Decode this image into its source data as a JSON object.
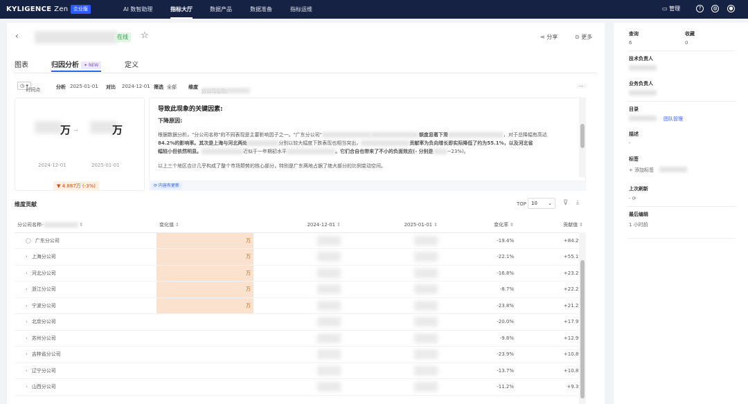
{
  "nav": {
    "brand": "KYLIGENCE",
    "brand_suffix": "Zen",
    "edition": "企业版",
    "items": [
      "AI 数智助理",
      "指标大厅",
      "数据产品",
      "数据准备",
      "指标运维"
    ],
    "active_index": 1,
    "manage": "管理"
  },
  "header": {
    "status": "在线",
    "share": "分享",
    "more": "更多"
  },
  "tabs": [
    {
      "label": "图表"
    },
    {
      "label": "归因分析",
      "badge": "NEW"
    },
    {
      "label": "定义"
    }
  ],
  "filter_bar": {
    "time": "时间点",
    "analyze_label": "分析",
    "analyze_value": "2025-01-01",
    "compare_label": "对比",
    "compare_value": "2024-12-01",
    "filter_label": "筛选",
    "filter_value": "全部",
    "dim_label": "维度",
    "dim_value": "分公司名称,",
    "more": "···"
  },
  "kpi": {
    "unit_a": "万",
    "unit_b": "万",
    "arrow": "→",
    "date_a": "2024-12-01",
    "date_b": "2025-01-01",
    "delta": "▼ 4.887万 (-3%)"
  },
  "analysis": {
    "heading": "导致此现象的关键因素:",
    "subheading": "下降原因:",
    "p1_a": "根据数据分析，\"分公司名称\"的不同表现是主要影响因子之一。\"广东分公司\"",
    "p1_b": "额度显著下滑",
    "p1_c": "，对于总降幅有高达",
    "p2_a": "84.2%的影响率。其次是上海与河北两处",
    "p2_b": "分别以较大幅度下跌表现也相当突出，",
    "p2_c": "贡献率为负向增长即实际降低了约为55.1%，以及河北省",
    "p3_a": "幅较小但依然明显。",
    "p3_b": "近似于一年期初水平",
    "p3_c": "。它们合自也带来了不小的负面效应(- 分别是",
    "p3_d": "~23%)。",
    "p4": "以上三个地区合计几乎构成了整个市场颓势的核心部分，特别是广东两地占据了绝大部分的比例变动空间。",
    "updated": "⟳ 内容有更新"
  },
  "dimension": {
    "title": "维度贡献",
    "top_label": "TOP",
    "top_value": "10",
    "columns": [
      "分公司名称-",
      "变化值",
      "2024-12-01",
      "2025-01-01",
      "变化率",
      "贡献值"
    ],
    "rows": [
      {
        "name": "广东分公司",
        "unit": "万",
        "rate": "-19.4%",
        "contrib": "+84.2%"
      },
      {
        "name": "上海分公司",
        "unit": "万",
        "rate": "-22.1%",
        "contrib": "+55.1%"
      },
      {
        "name": "河北分公司",
        "unit": "万",
        "rate": "-16.8%",
        "contrib": "+23.2%"
      },
      {
        "name": "浙江分公司",
        "unit": "万",
        "rate": "-8.7%",
        "contrib": "+22.2%"
      },
      {
        "name": "宁波分公司",
        "unit": "万",
        "rate": "-23.8%",
        "contrib": "+21.2%"
      },
      {
        "name": "北京分公司",
        "unit": "",
        "rate": "-20.0%",
        "contrib": "+17.9%"
      },
      {
        "name": "苏州分公司",
        "unit": "",
        "rate": "-9.8%",
        "contrib": "+12.9%"
      },
      {
        "name": "吉林省分公司",
        "unit": "",
        "rate": "-23.9%",
        "contrib": "+10.8%"
      },
      {
        "name": "辽宁分公司",
        "unit": "",
        "rate": "-13.7%",
        "contrib": "+10.8%"
      },
      {
        "name": "山西分公司",
        "unit": "",
        "rate": "-11.2%",
        "contrib": "+9.3%"
      }
    ]
  },
  "side": {
    "query_label": "查询",
    "query_value": "6",
    "fav_label": "收藏",
    "fav_value": "0",
    "tech_owner": "技术负责人",
    "biz_owner": "业务负责人",
    "catalog": "目录",
    "catalog_link": "团队管理",
    "desc_label": "描述",
    "desc_value": "-",
    "tags_label": "标签",
    "add_tag": "+ 添加标签",
    "last_refresh": "上次刷新",
    "last_refresh_value": "- ⟳",
    "last_edit": "最后编辑",
    "last_edit_value": "1 小时前"
  }
}
